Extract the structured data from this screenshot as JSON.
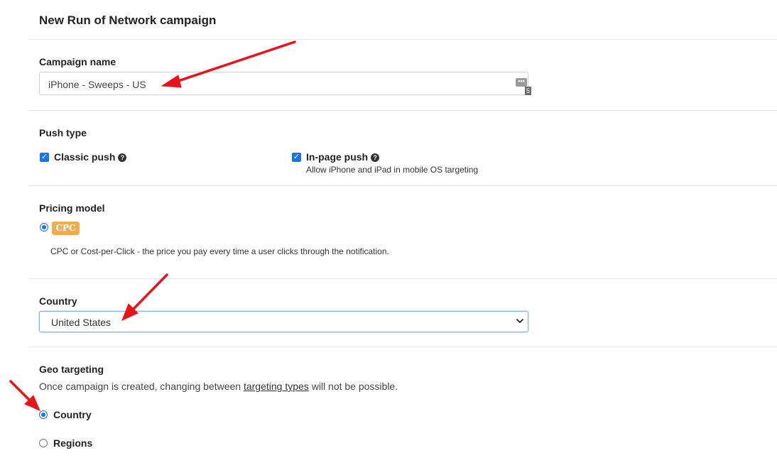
{
  "page": {
    "title": "New Run of Network campaign"
  },
  "campaign_name": {
    "label": "Campaign name",
    "value": "iPhone - Sweeps - US",
    "counter": "5",
    "dots": "•••"
  },
  "push_type": {
    "label": "Push type",
    "classic": {
      "label": "Classic push",
      "checked": true,
      "help": "?"
    },
    "inpage": {
      "label": "In-page push",
      "checked": true,
      "help": "?",
      "hint": "Allow iPhone and iPad in mobile OS targeting"
    }
  },
  "pricing_model": {
    "label": "Pricing model",
    "badge": "CPC",
    "selected": true,
    "description": "CPC or Cost-per-Click - the price you pay every time a user clicks through the notification."
  },
  "country": {
    "label": "Country",
    "selected": "United States"
  },
  "geo_targeting": {
    "label": "Geo targeting",
    "description_before": "Once campaign is created, changing between ",
    "description_link": "targeting types",
    "description_after": " will not be possible.",
    "options": [
      {
        "label": "Country",
        "selected": true
      },
      {
        "label": "Regions",
        "selected": false
      }
    ]
  },
  "colors": {
    "accent": "#1a73e8",
    "badge": "#f0ad4e",
    "annotation_arrow": "#e8141b"
  },
  "icons": {
    "checkbox_check": "✓"
  }
}
